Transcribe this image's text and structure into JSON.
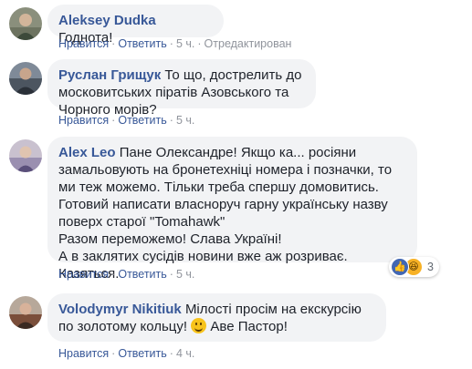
{
  "comments": [
    {
      "author": "Aleksey Dudka",
      "text": "Годнота!",
      "like_label": "Нравится",
      "reply_label": "Ответить",
      "time": "5 ч.",
      "edited": "Отредактирован"
    },
    {
      "author": "Руслан Грищук",
      "text": "То що, дострелить до московитських піратів Азовського та Чорного морів?",
      "like_label": "Нравится",
      "reply_label": "Ответить",
      "time": "5 ч."
    },
    {
      "author": "Alex Leo",
      "text": "Пане Олександре! Якщо ка... росіяни замальовують на бронетехніці номера і позначки, то ми теж можемо. Тільки треба спершу домовитись. Готовий написати власноруч гарну українську назву поверх старої \"Tomahawk\"",
      "line2": "Разом переможемо! Слава Україні!",
      "line3": "А в заклятих сусідів новини вже аж розриває. Казяться.",
      "like_label": "Нравится",
      "reply_label": "Ответить",
      "time": "5 ч.",
      "reactions": {
        "icons": [
          "like-icon",
          "haha-icon"
        ],
        "count": "3"
      }
    },
    {
      "author": "Volodymyr Nikitiuk",
      "text_before": "Мілості просім на екскурсію по золотому кольцу!",
      "emoji": "smile-emoji",
      "text_after": "Аве Пастор!",
      "like_label": "Нравится",
      "reply_label": "Ответить",
      "time": "4 ч."
    }
  ],
  "colors": {
    "link": "#385898",
    "bubble": "#f2f3f5",
    "muted": "#90949c",
    "like": "#4267b2",
    "haha": "#f7b125"
  }
}
